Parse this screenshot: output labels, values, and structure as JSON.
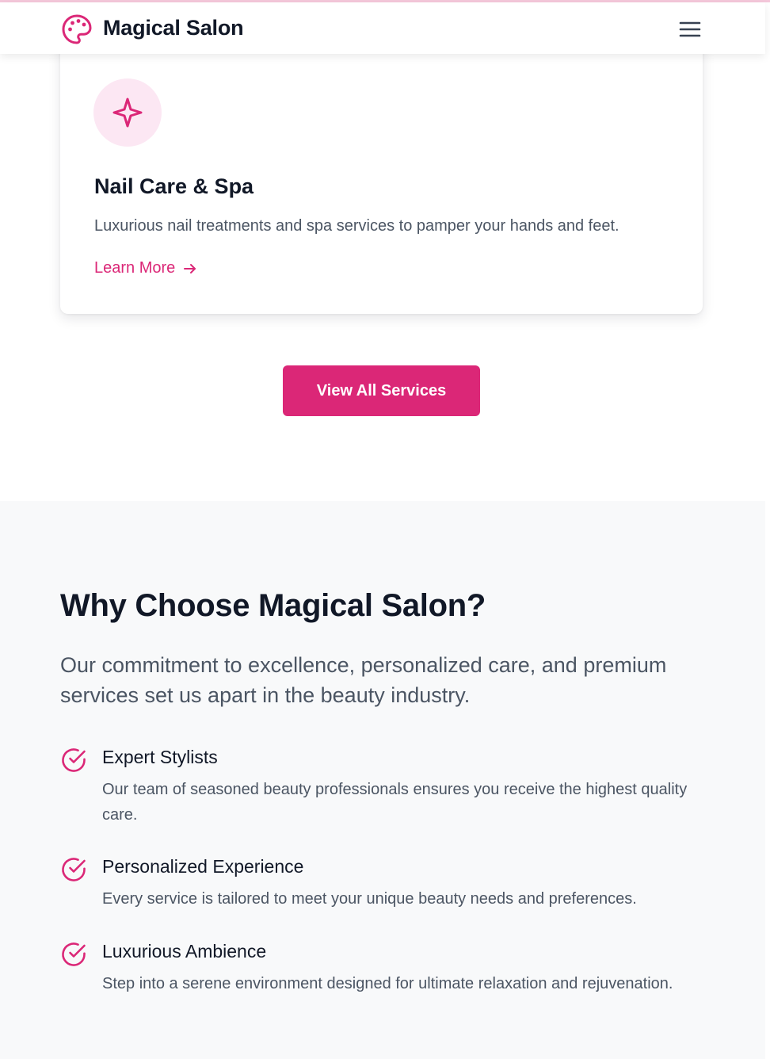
{
  "header": {
    "brand": "Magical Salon",
    "logo_icon": "palette-icon",
    "menu_icon": "hamburger-menu-icon"
  },
  "service_card": {
    "icon": "sparkle-icon",
    "title": "Nail Care & Spa",
    "description": "Luxurious nail treatments and spa services to pamper your hands and feet.",
    "link_label": "Learn More",
    "link_icon": "arrow-right-icon"
  },
  "cta": {
    "label": "View All Services"
  },
  "why": {
    "title": "Why Choose Magical Salon?",
    "description": "Our commitment to excellence, personalized care, and premium services set us apart in the beauty industry.",
    "features": [
      {
        "icon": "check-circle-icon",
        "title": "Expert Stylists",
        "description": "Our team of seasoned beauty professionals ensures you receive the highest quality care."
      },
      {
        "icon": "check-circle-icon",
        "title": "Personalized Experience",
        "description": "Every service is tailored to meet your unique beauty needs and preferences."
      },
      {
        "icon": "check-circle-icon",
        "title": "Luxurious Ambience",
        "description": "Step into a serene environment designed for ultimate relaxation and rejuvenation."
      }
    ]
  },
  "colors": {
    "accent": "#db2777",
    "accent_light": "#fce7f3",
    "text_dark": "#111827",
    "text_muted": "#4b5563",
    "section_bg": "#f8f9fa"
  }
}
